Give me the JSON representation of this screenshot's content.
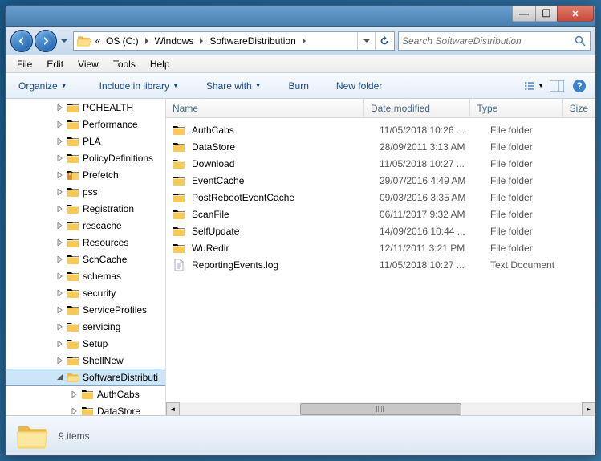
{
  "titlebar": {
    "min": "—",
    "max": "❐",
    "close": "✕"
  },
  "breadcrumb": {
    "prefix": "«",
    "items": [
      "OS (C:)",
      "Windows",
      "SoftwareDistribution"
    ]
  },
  "search": {
    "placeholder": "Search SoftwareDistribution"
  },
  "menubar": [
    "File",
    "Edit",
    "View",
    "Tools",
    "Help"
  ],
  "toolbar": {
    "organize": "Organize",
    "include": "Include in library",
    "share": "Share with",
    "burn": "Burn",
    "newfolder": "New folder"
  },
  "sidebar": {
    "items": [
      {
        "label": "PCHEALTH",
        "indent": 54,
        "icon": "folder"
      },
      {
        "label": "Performance",
        "indent": 54,
        "icon": "folder"
      },
      {
        "label": "PLA",
        "indent": 54,
        "icon": "folder"
      },
      {
        "label": "PolicyDefinitions",
        "indent": 54,
        "icon": "folder"
      },
      {
        "label": "Prefetch",
        "indent": 54,
        "icon": "folder-lock"
      },
      {
        "label": "pss",
        "indent": 54,
        "icon": "folder"
      },
      {
        "label": "Registration",
        "indent": 54,
        "icon": "folder"
      },
      {
        "label": "rescache",
        "indent": 54,
        "icon": "folder"
      },
      {
        "label": "Resources",
        "indent": 54,
        "icon": "folder"
      },
      {
        "label": "SchCache",
        "indent": 54,
        "icon": "folder"
      },
      {
        "label": "schemas",
        "indent": 54,
        "icon": "folder"
      },
      {
        "label": "security",
        "indent": 54,
        "icon": "folder"
      },
      {
        "label": "ServiceProfiles",
        "indent": 54,
        "icon": "folder"
      },
      {
        "label": "servicing",
        "indent": 54,
        "icon": "folder"
      },
      {
        "label": "Setup",
        "indent": 54,
        "icon": "folder"
      },
      {
        "label": "ShellNew",
        "indent": 54,
        "icon": "folder"
      },
      {
        "label": "SoftwareDistributi",
        "indent": 54,
        "icon": "folder-open",
        "selected": true,
        "expand": "open"
      },
      {
        "label": "AuthCabs",
        "indent": 72,
        "icon": "folder"
      },
      {
        "label": "DataStore",
        "indent": 72,
        "icon": "folder"
      }
    ]
  },
  "columns": {
    "name": "Name",
    "date": "Date modified",
    "type": "Type",
    "size": "Size"
  },
  "files": [
    {
      "name": "AuthCabs",
      "date": "11/05/2018 10:26 ...",
      "type": "File folder",
      "icon": "folder"
    },
    {
      "name": "DataStore",
      "date": "28/09/2011 3:13 AM",
      "type": "File folder",
      "icon": "folder"
    },
    {
      "name": "Download",
      "date": "11/05/2018 10:27 ...",
      "type": "File folder",
      "icon": "folder"
    },
    {
      "name": "EventCache",
      "date": "29/07/2016 4:49 AM",
      "type": "File folder",
      "icon": "folder"
    },
    {
      "name": "PostRebootEventCache",
      "date": "09/03/2016 3:35 AM",
      "type": "File folder",
      "icon": "folder"
    },
    {
      "name": "ScanFile",
      "date": "06/11/2017 9:32 AM",
      "type": "File folder",
      "icon": "folder"
    },
    {
      "name": "SelfUpdate",
      "date": "14/09/2016 10:44 ...",
      "type": "File folder",
      "icon": "folder"
    },
    {
      "name": "WuRedir",
      "date": "12/11/2011 3:21 PM",
      "type": "File folder",
      "icon": "folder"
    },
    {
      "name": "ReportingEvents.log",
      "date": "11/05/2018 10:27 ...",
      "type": "Text Document",
      "icon": "text"
    }
  ],
  "status": {
    "count": "9 items"
  }
}
